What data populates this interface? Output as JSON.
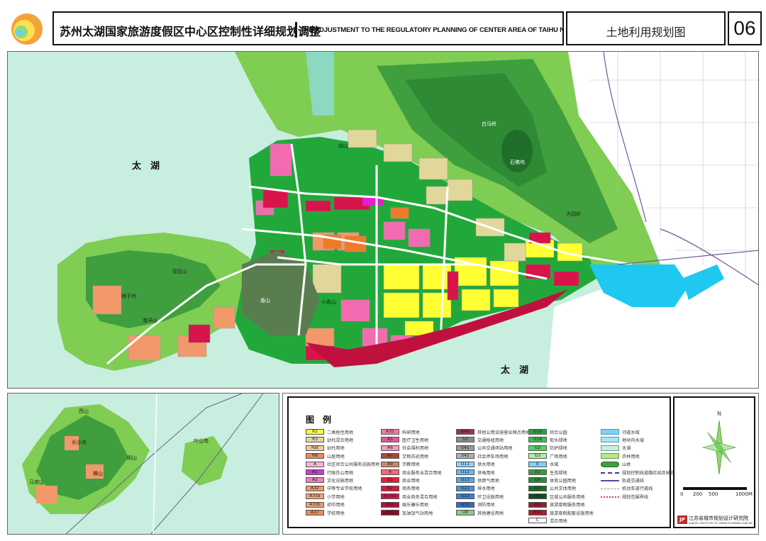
{
  "header": {
    "title_zh": "苏州太湖国家旅游度假区中心区控制性详细规划调整",
    "title_en": "THE ADJUSTMENT TO THE REGULATORY PLANNING OF CENTER AREA OF TAIHU NATIONAL TOURIST RESORT IN SUZHOU",
    "sheet_title": "土地利用规划图",
    "sheet_number": "06"
  },
  "colors": {
    "lake": "#c5eedd",
    "mountain_dark": "#3c9c3c",
    "mountain_mid": "#7fcd52",
    "mountain_light": "#a6e07c",
    "green_space": "#22a83a",
    "residential": "#ffff33",
    "residential_alt": "#e2d79b",
    "commercial": "#d8144a",
    "public": "#f26bb0",
    "education": "#f2986a",
    "road": "#ffffff",
    "water": "#1ec8f0",
    "dark_green_hill": "#5a7d50"
  },
  "main_map": {
    "labels": {
      "lake_west": "太　湖",
      "lake_south": "太　湖",
      "hill_bailing": "白马岭",
      "hill_shifoling": "石佛坞",
      "hill_dawuling": "大园岭",
      "hill_shuangqianshan": "双后山",
      "hill_shizisi": "狮子坞",
      "hill_yuyang": "渔洋山",
      "hill_xiangshan": "香山",
      "hill_xiaoxiangshan": "小香山",
      "hill_hushan": "胡山"
    }
  },
  "inset_map": {
    "labels": [
      "长沙岛",
      "横山",
      "叶山岛",
      "阴山",
      "西山",
      "马迹山"
    ]
  },
  "legend": {
    "title": "图　例",
    "col1": [
      {
        "code": "R2",
        "label": "二类居住用地",
        "color": "#ffff33"
      },
      {
        "code": "R3",
        "label": "幼托混合用地",
        "color": "#e2d79b"
      },
      {
        "code": "Rat",
        "label": "幼托用地",
        "color": "#f7c79b"
      },
      {
        "code": "R8",
        "label": "山居用地",
        "color": "#e98a62"
      },
      {
        "code": "A",
        "label": "社区综合公共服务设施用地",
        "color": "#f4b6d2"
      },
      {
        "code": "A1",
        "label": "行政办公用地",
        "color": "#c23fd1"
      },
      {
        "code": "A2",
        "label": "文化设施用地",
        "color": "#f07eb8"
      },
      {
        "code": "A32",
        "label": "中等专业学校用地",
        "color": "#f2986a"
      },
      {
        "code": "A33a",
        "label": "小学用地",
        "color": "#f5a878"
      },
      {
        "code": "A33b",
        "label": "初中用地",
        "color": "#f3a070"
      },
      {
        "code": "A37",
        "label": "学校用地",
        "color": "#e58f60"
      }
    ],
    "col2": [
      {
        "code": "A35",
        "label": "科研用地",
        "color": "#f27a9e"
      },
      {
        "code": "A5",
        "label": "医疗卫生用地",
        "color": "#e6569a"
      },
      {
        "code": "A6",
        "label": "社会福利用地",
        "color": "#f29ac0"
      },
      {
        "code": "A7",
        "label": "文物古迹用地",
        "color": "#a8483c"
      },
      {
        "code": "A9",
        "label": "宗教用地",
        "color": "#cc8866"
      },
      {
        "code": "A",
        "label": "商业服务业混合用地",
        "color": "#f06a7a"
      },
      {
        "code": "B1",
        "label": "商业用地",
        "color": "#e8203e"
      },
      {
        "code": "B2",
        "label": "商务用地",
        "color": "#d61a3a"
      },
      {
        "code": "B1/B2",
        "label": "商业商务混合用地",
        "color": "#d8144a"
      },
      {
        "code": "B31",
        "label": "娱乐康乐用地",
        "color": "#b21040"
      },
      {
        "code": "B41",
        "label": "加油加气站用地",
        "color": "#8c0c2c"
      }
    ],
    "col3": [
      {
        "code": "B49",
        "label": "其他公用设施营业网点用地",
        "color": "#a0324c"
      },
      {
        "code": "S3",
        "label": "交通枢纽用地",
        "color": "#8a8a8a"
      },
      {
        "code": "S41",
        "label": "公共交通场站用地",
        "color": "#9a9a9a"
      },
      {
        "code": "S42",
        "label": "社会停车场用地",
        "color": "#b0b0b0"
      },
      {
        "code": "U11",
        "label": "供水用地",
        "color": "#8fd0ff"
      },
      {
        "code": "U12",
        "label": "供电用地",
        "color": "#6fb8f0"
      },
      {
        "code": "U13",
        "label": "供燃气用地",
        "color": "#5aa6e6"
      },
      {
        "code": "U21",
        "label": "排水用地",
        "color": "#4c90d8"
      },
      {
        "code": "U22",
        "label": "环卫设施用地",
        "color": "#3c80cc"
      },
      {
        "code": "U31",
        "label": "消防用地",
        "color": "#2c70c0"
      },
      {
        "code": "U9",
        "label": "其他建设用地",
        "color": "#90c890"
      }
    ],
    "col4": [
      {
        "code": "G1a",
        "label": "综合公园",
        "color": "#22a83a"
      },
      {
        "code": "G1b",
        "label": "街头绿地",
        "color": "#3cbf4c"
      },
      {
        "code": "G2",
        "label": "防护绿地",
        "color": "#4fd65a"
      },
      {
        "code": "G3",
        "label": "广场用地",
        "color": "#aef0a0"
      },
      {
        "code": "E",
        "label": "水域",
        "color": "#7fd3f0"
      },
      {
        "code": "E1",
        "label": "生态绿地",
        "color": "#3c9c3c"
      },
      {
        "code": "G4",
        "label": "体育公园用地",
        "color": "#2a8a3a"
      },
      {
        "code": "G5",
        "label": "公共文体用地",
        "color": "#186c28"
      },
      {
        "code": "A8",
        "label": "区域公共服务用地",
        "color": "#125020"
      },
      {
        "code": "B9",
        "label": "旅游度假服务用地",
        "color": "#902030"
      },
      {
        "code": "B91",
        "label": "旅游度假配套设施用地",
        "color": "#b01c2a"
      },
      {
        "code": "C",
        "label": "混合用地",
        "color": "#ffffff"
      }
    ],
    "col5": [
      {
        "label": "河道水域",
        "kind": "water"
      },
      {
        "label": "地块内水域",
        "kind": "water2"
      },
      {
        "label": "太湖",
        "kind": "lake"
      },
      {
        "label": "农林用地",
        "kind": "farm"
      },
      {
        "label": "山体",
        "kind": "hill"
      },
      {
        "label": "规划控制线道路红线及轴线",
        "kind": "line1"
      },
      {
        "label": "轨道交通线",
        "kind": "line2"
      },
      {
        "label": "机动车道行道线",
        "kind": "line3"
      },
      {
        "label": "规划范围界线",
        "kind": "line4"
      }
    ],
    "north_label": "N",
    "scale_labels": [
      "0",
      "200",
      "500",
      "1000M"
    ],
    "institute_zh": "江苏省城市规划设计研究院",
    "institute_en": "JIANGSU INSTITUTE OF URBAN PLANNING AND DESIGN",
    "institute_logo_text": "JP"
  }
}
